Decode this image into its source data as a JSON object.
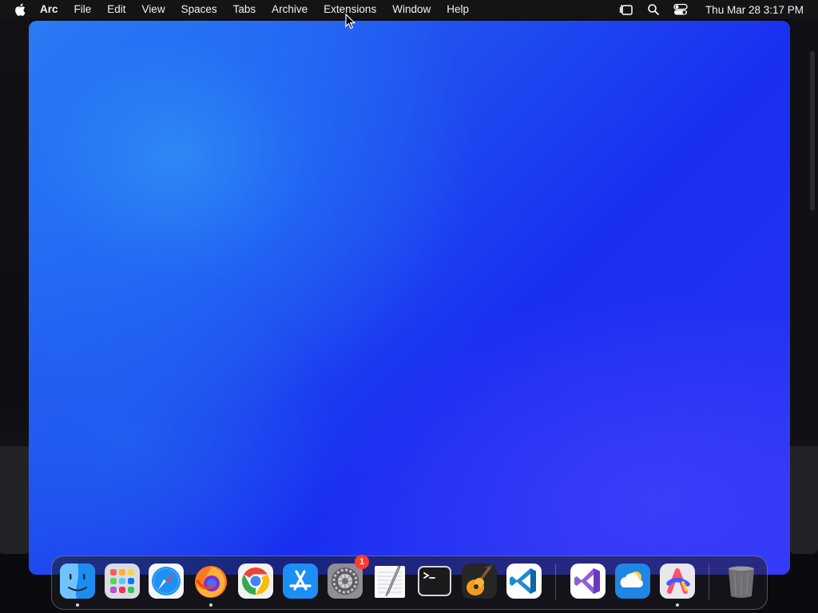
{
  "menubar": {
    "app_name": "Arc",
    "items": [
      "File",
      "Edit",
      "View",
      "Spaces",
      "Tabs",
      "Archive",
      "Extensions",
      "Window",
      "Help"
    ],
    "clock": "Thu Mar 28  3:17 PM",
    "tray_icons": [
      "stage-manager-icon",
      "search-icon",
      "control-center-icon"
    ]
  },
  "dock": {
    "apps": [
      {
        "name": "Finder",
        "icon": "finder-icon",
        "running": true
      },
      {
        "name": "Launchpad",
        "icon": "launchpad-icon",
        "running": false
      },
      {
        "name": "Safari",
        "icon": "safari-icon",
        "running": false
      },
      {
        "name": "Firefox",
        "icon": "firefox-icon",
        "running": true
      },
      {
        "name": "Google Chrome",
        "icon": "chrome-icon",
        "running": false
      },
      {
        "name": "App Store",
        "icon": "app-store-icon",
        "running": false
      },
      {
        "name": "System Settings",
        "icon": "system-settings-icon",
        "running": false,
        "badge": "1"
      },
      {
        "name": "TextEdit",
        "icon": "textedit-icon",
        "running": false
      },
      {
        "name": "Terminal",
        "icon": "terminal-icon",
        "running": false
      },
      {
        "name": "GarageBand",
        "icon": "garageband-icon",
        "running": false
      },
      {
        "name": "Visual Studio Code",
        "icon": "vscode-icon",
        "running": false
      },
      {
        "name": "Visual Studio",
        "icon": "visual-studio-icon",
        "running": false
      },
      {
        "name": "Weather",
        "icon": "weather-icon",
        "running": false
      },
      {
        "name": "Arc",
        "icon": "arc-icon",
        "running": true
      },
      {
        "name": "Trash",
        "icon": "trash-icon",
        "running": false
      }
    ]
  },
  "colors": {
    "window_gradient_light": "#2e8af6",
    "window_gradient_dark": "#1a2ff0",
    "badge": "#ff3b30"
  }
}
